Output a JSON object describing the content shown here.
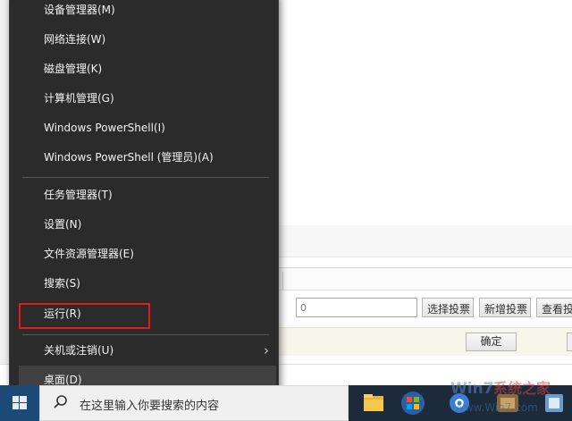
{
  "context_menu": {
    "items": [
      {
        "label": "设备管理器(M)"
      },
      {
        "label": "网络连接(W)"
      },
      {
        "label": "磁盘管理(K)"
      },
      {
        "label": "计算机管理(G)"
      },
      {
        "label": "Windows PowerShell(I)"
      },
      {
        "label": "Windows PowerShell (管理员)(A)"
      },
      {
        "label": "任务管理器(T)"
      },
      {
        "label": "设置(N)"
      },
      {
        "label": "文件资源管理器(E)"
      },
      {
        "label": "搜索(S)"
      },
      {
        "label": "运行(R)"
      },
      {
        "label": "关机或注销(U)",
        "has_submenu": true
      },
      {
        "label": "桌面(D)",
        "hovered": true
      }
    ],
    "highlighted_item": "运行(R)",
    "highlight_color": "#e41b1b"
  },
  "background_app": {
    "vote_input_value": "0",
    "buttons": {
      "select_vote": "选择投票",
      "add_vote": "新增投票",
      "view_vote": "查看投"
    },
    "confirm_label": "确定"
  },
  "taskbar": {
    "search_placeholder": "在这里输入你要搜索的内容",
    "icons": [
      "windows-start-icon",
      "search-icon",
      "file-explorer-icon",
      "windows-logo-icon",
      "browser-icon",
      "game-icon",
      "app-icon"
    ]
  },
  "watermark": {
    "text": "Win7系统之家"
  }
}
